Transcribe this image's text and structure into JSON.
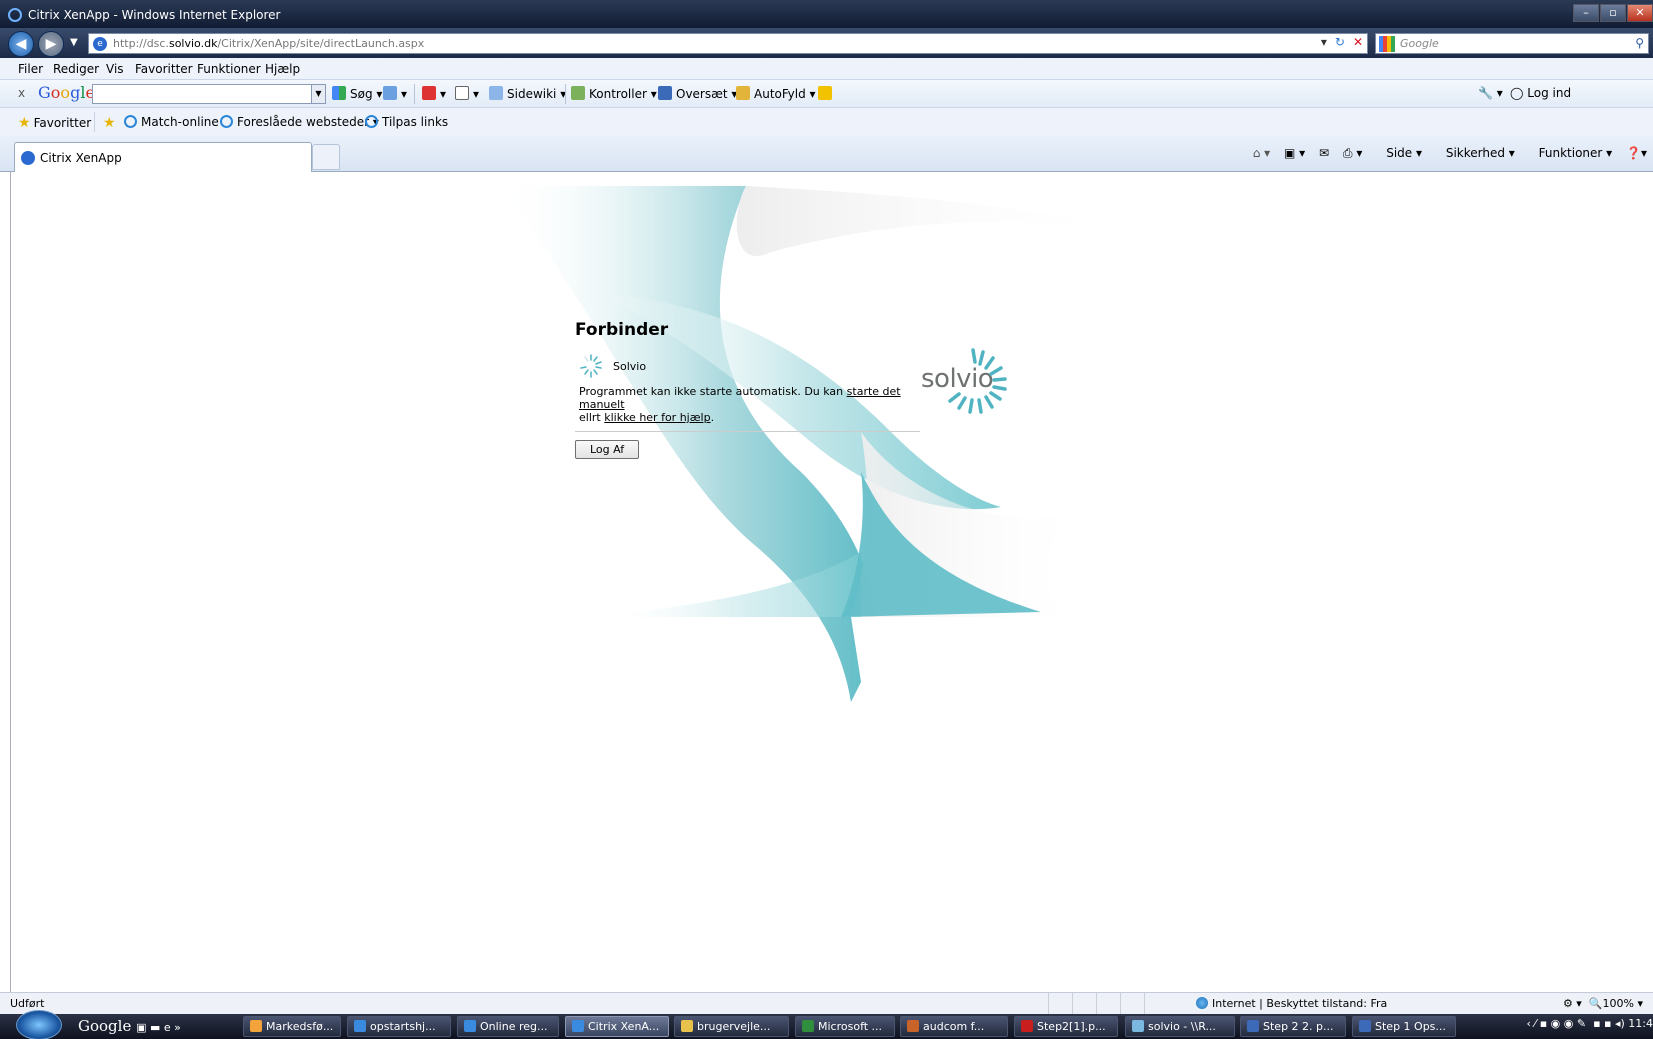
{
  "window": {
    "title": "Citrix XenApp - Windows Internet Explorer",
    "controls": [
      "–",
      "▫",
      "✕"
    ]
  },
  "address": {
    "url_prefix": "http://dsc.",
    "url_domain": "solvio.dk",
    "url_path": "/Citrix/XenApp/site/directLaunch.aspx",
    "search_placeholder": "Google"
  },
  "menu": [
    "Filer",
    "Rediger",
    "Vis",
    "Favoritter",
    "Funktioner",
    "Hjælp"
  ],
  "google_toolbar": {
    "close": "x",
    "search_label": "Søg",
    "sidewiki": "Sidewiki",
    "kontroller": "Kontroller",
    "oversaet": "Oversæt",
    "autofyld": "AutoFyld",
    "login": "Log ind"
  },
  "favorites_bar": {
    "favorites_label": "Favoritter",
    "links": [
      "Match-online",
      "Foreslåede websteder ▾",
      "Tilpas links"
    ]
  },
  "tabs": {
    "active_label": "Citrix XenApp"
  },
  "command_bar": {
    "side": "Side",
    "sikkerhed": "Sikkerhed",
    "funktioner": "Funktioner"
  },
  "page": {
    "heading": "Forbinder",
    "app_name": "Solvio",
    "message_part1": "Programmet kan ikke starte automatisk. Du kan ",
    "message_link1": "starte det manuelt",
    "message_part2": "ellrt ",
    "message_link2": "klikke her for hjælp",
    "message_part3": ".",
    "logout_label": "Log Af",
    "logo_text": "solvio"
  },
  "status": {
    "left": "Udført",
    "zone": "Internet | Beskyttet tilstand: Fra",
    "zoom": "100%"
  },
  "taskbar": {
    "quick_launch": "Google",
    "tasks": [
      {
        "label": "Markedsfø...",
        "color": "#f2a33a"
      },
      {
        "label": "opstartshj...",
        "color": "#3a8be0"
      },
      {
        "label": "Online reg...",
        "color": "#3a8be0"
      },
      {
        "label": "Citrix XenA...",
        "color": "#3a8be0",
        "active": true
      },
      {
        "label": "brugervejle...",
        "color": "#e8c24a"
      },
      {
        "label": "Microsoft ...",
        "color": "#2f8f3d"
      },
      {
        "label": "audcom f...",
        "color": "#c8642a"
      },
      {
        "label": "Step2[1].p...",
        "color": "#c81e1e"
      },
      {
        "label": "solvio - \\\\R...",
        "color": "#7ab8e0"
      },
      {
        "label": "Step 2 2. p...",
        "color": "#3c6ab8"
      },
      {
        "label": "Step 1 Ops...",
        "color": "#3c6ab8"
      }
    ],
    "clock": "11:4"
  }
}
